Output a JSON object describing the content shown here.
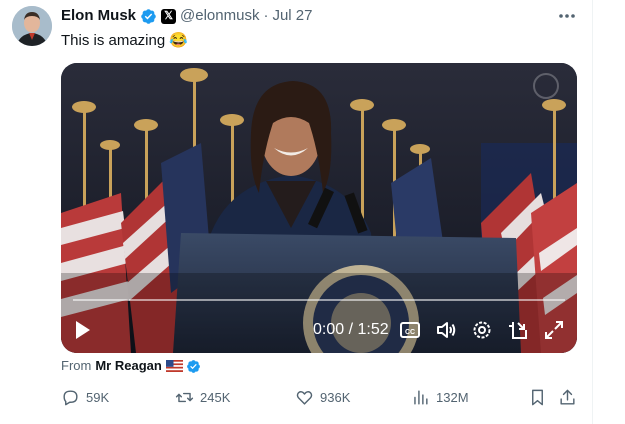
{
  "author": {
    "name": "Elon Musk",
    "handle": "@elonmusk",
    "separator": "·",
    "date": "Jul 27"
  },
  "tweet": {
    "text": "This is amazing 😂"
  },
  "video": {
    "time": "0:00 / 1:52",
    "progress": 0
  },
  "attribution": {
    "label": "From",
    "user": "Mr Reagan"
  },
  "actions": {
    "replies": "59K",
    "reposts": "245K",
    "likes": "936K",
    "views": "132M"
  },
  "colors": {
    "verified": "#1d9bf0",
    "secondary_text": "#536471",
    "primary_text": "#0f1419"
  },
  "icons": [
    "verified-badge-icon",
    "x-logo-icon",
    "more-icon",
    "play-icon",
    "captions-icon",
    "volume-icon",
    "settings-icon",
    "pip-icon",
    "fullscreen-icon",
    "us-flag-icon",
    "reply-icon",
    "repost-icon",
    "like-icon",
    "views-icon",
    "bookmark-icon",
    "share-icon"
  ]
}
